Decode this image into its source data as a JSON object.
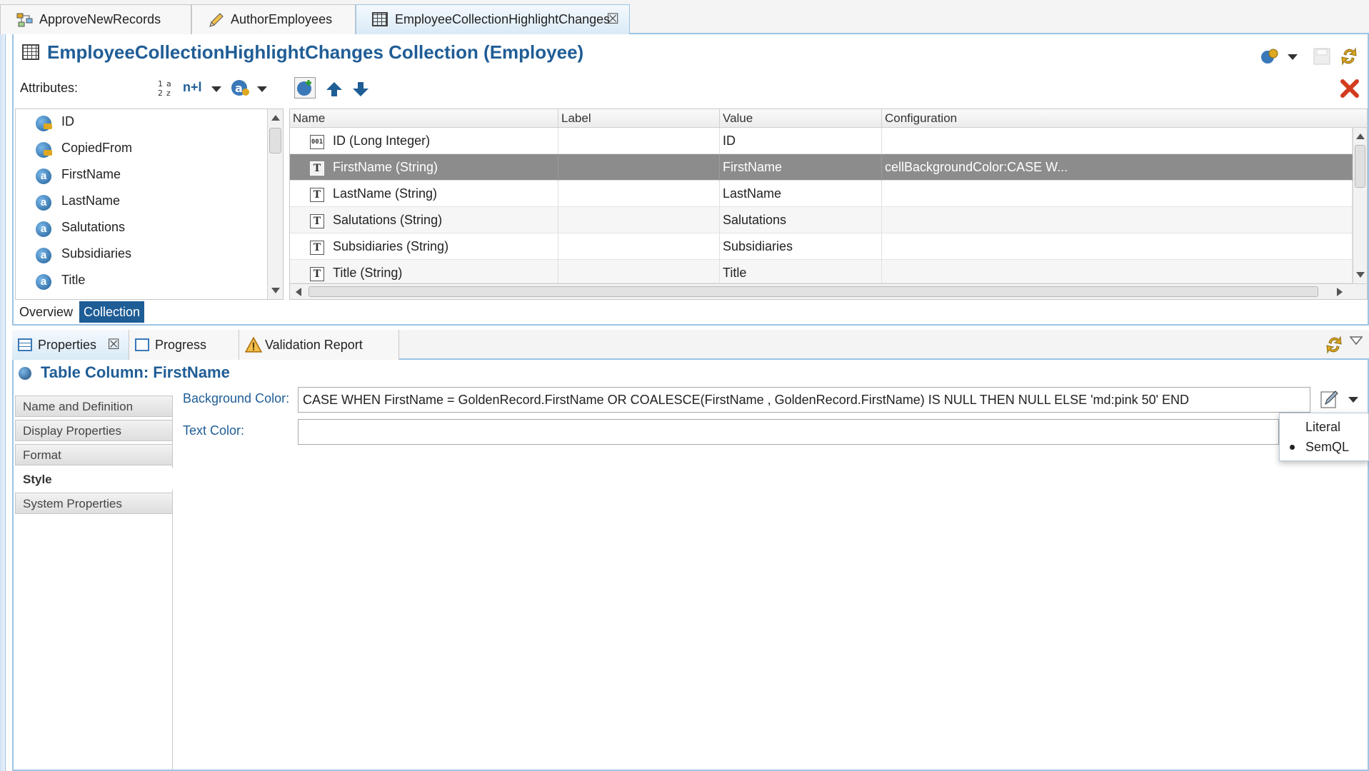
{
  "editor_tabs": [
    {
      "label": "ApproveNewRecords",
      "icon": "workflow-icon"
    },
    {
      "label": "AuthorEmployees",
      "icon": "pencil-icon"
    },
    {
      "label": "EmployeeCollectionHighlightChanges",
      "icon": "table-icon",
      "active": true
    }
  ],
  "editor": {
    "title": "EmployeeCollectionHighlightChanges Collection (Employee)",
    "attributes_label": "Attributes:",
    "sort_toolbar_text": "n+l",
    "attributes": [
      {
        "label": "ID",
        "icon": "key-attribute-icon"
      },
      {
        "label": "CopiedFrom",
        "icon": "key-attribute-icon"
      },
      {
        "label": "FirstName",
        "icon": "attribute-icon"
      },
      {
        "label": "LastName",
        "icon": "attribute-icon"
      },
      {
        "label": "Salutations",
        "icon": "attribute-icon"
      },
      {
        "label": "Subsidiaries",
        "icon": "attribute-icon"
      },
      {
        "label": "Title",
        "icon": "attribute-icon"
      }
    ],
    "attribute_icon_glyph": "a",
    "columns": {
      "headers": [
        "Name",
        "Label",
        "Value",
        "Configuration"
      ],
      "rows": [
        {
          "icon": "001",
          "name": "ID (Long Integer)",
          "label": "",
          "value": "ID",
          "config": ""
        },
        {
          "icon": "T",
          "name": "FirstName (String)",
          "label": "",
          "value": "FirstName",
          "config": "cellBackgroundColor:CASE W...",
          "selected": true
        },
        {
          "icon": "T",
          "name": "LastName (String)",
          "label": "",
          "value": "LastName",
          "config": ""
        },
        {
          "icon": "T",
          "name": "Salutations (String)",
          "label": "",
          "value": "Salutations",
          "config": ""
        },
        {
          "icon": "T",
          "name": "Subsidiaries (String)",
          "label": "",
          "value": "Subsidiaries",
          "config": ""
        },
        {
          "icon": "T",
          "name": "Title (String)",
          "label": "",
          "value": "Title",
          "config": ""
        }
      ]
    },
    "bottom_tabs": [
      {
        "label": "Overview"
      },
      {
        "label": "Collection",
        "active": true
      }
    ]
  },
  "views": {
    "tabs": [
      {
        "label": "Properties",
        "active": true
      },
      {
        "label": "Progress"
      },
      {
        "label": "Validation Report"
      }
    ]
  },
  "properties": {
    "title": "Table Column: FirstName",
    "sections": [
      {
        "label": "Name and Definition"
      },
      {
        "label": "Display Properties"
      },
      {
        "label": "Format"
      },
      {
        "label": "Style",
        "active": true
      },
      {
        "label": "System Properties"
      }
    ],
    "background_color": {
      "label": "Background Color:",
      "value": "CASE WHEN FirstName = GoldenRecord.FirstName OR COALESCE(FirstName , GoldenRecord.FirstName) IS NULL THEN NULL ELSE 'md:pink 50' END"
    },
    "text_color": {
      "label": "Text Color:",
      "value": ""
    },
    "expression_mode_menu": {
      "options": [
        "Literal",
        "SemQL"
      ],
      "selected": "SemQL"
    }
  },
  "colors": {
    "accent": "#1f5d96",
    "frame": "#9cc4e4",
    "selected_row": "#8c8c8c",
    "delete": "#d23c1e"
  }
}
